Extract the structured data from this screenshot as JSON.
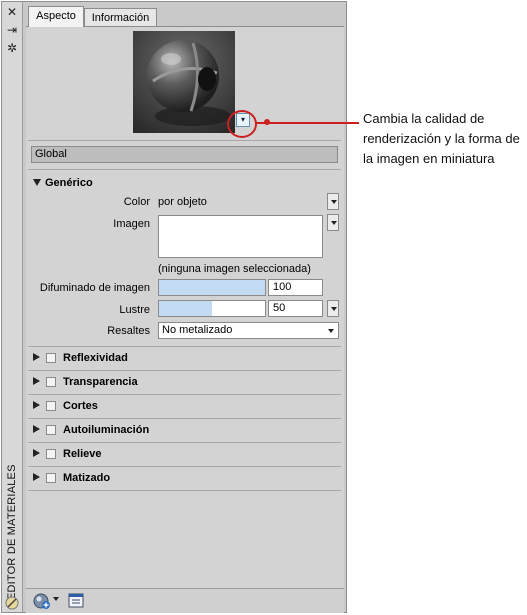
{
  "sidebar": {
    "title": "EDITOR DE MATERIALES",
    "icons": [
      "close-icon",
      "pin-icon",
      "settings-icon",
      "materials-icon"
    ]
  },
  "tabs": [
    {
      "label": "Aspecto",
      "active": true
    },
    {
      "label": "Información",
      "active": false
    }
  ],
  "preview": {
    "callout": "Cambia la calidad de renderización y la forma de la imagen en miniatura"
  },
  "material_name": "Global",
  "generic": {
    "header": "Genérico",
    "color_label": "Color",
    "color_value": "por objeto",
    "image_label": "Imagen",
    "image_caption": "(ninguna imagen seleccionada)",
    "fade_label": "Difuminado de imagen",
    "fade_value": "100",
    "fade_fraction": 1.0,
    "gloss_label": "Lustre",
    "gloss_value": "50",
    "gloss_fraction": 0.5,
    "highlights_label": "Resaltes",
    "highlights_value": "No metalizado"
  },
  "sections": [
    {
      "label": "Reflexividad"
    },
    {
      "label": "Transparencia"
    },
    {
      "label": "Cortes"
    },
    {
      "label": "Autoiluminación"
    },
    {
      "label": "Relieve"
    },
    {
      "label": "Matizado"
    }
  ],
  "colors": {
    "accent_red": "#cc1f1f",
    "slider_fill": "#c3dcf3"
  }
}
